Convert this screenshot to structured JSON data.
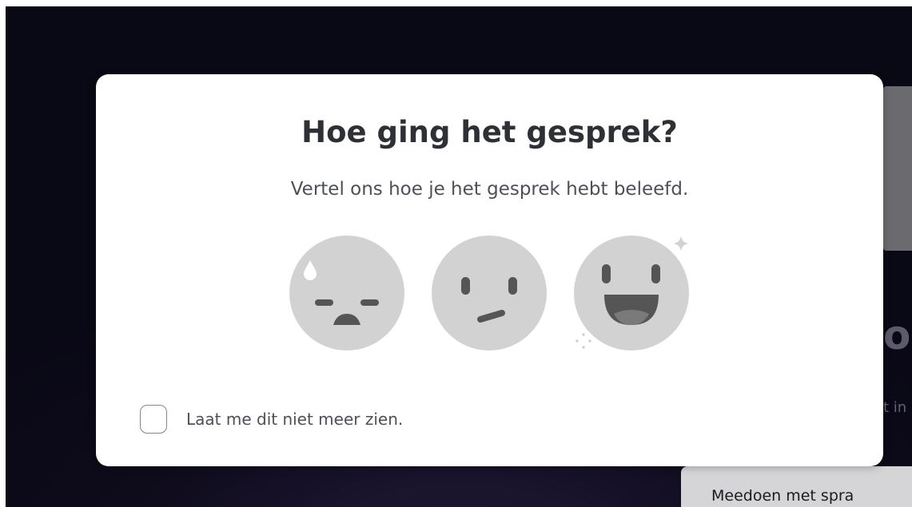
{
  "background": {
    "heading_fragment": "oe",
    "subtext_fragment": "t in",
    "join_button_label": "Meedoen met spra"
  },
  "modal": {
    "title": "Hoe ging het gesprek?",
    "subtitle": "Vertel ons hoe je het gesprek hebt beleefd.",
    "ratings": [
      {
        "icon": "sad-face-icon"
      },
      {
        "icon": "neutral-face-icon"
      },
      {
        "icon": "happy-face-icon"
      }
    ],
    "dont_show_again": {
      "label": "Laat me dit niet meer zien.",
      "checked": false
    }
  },
  "colors": {
    "face_fill": "#d2d2d2",
    "face_features": "#555555",
    "title_text": "#2e3035",
    "body_text": "#4e5058",
    "backdrop": "#0e0b1b"
  }
}
